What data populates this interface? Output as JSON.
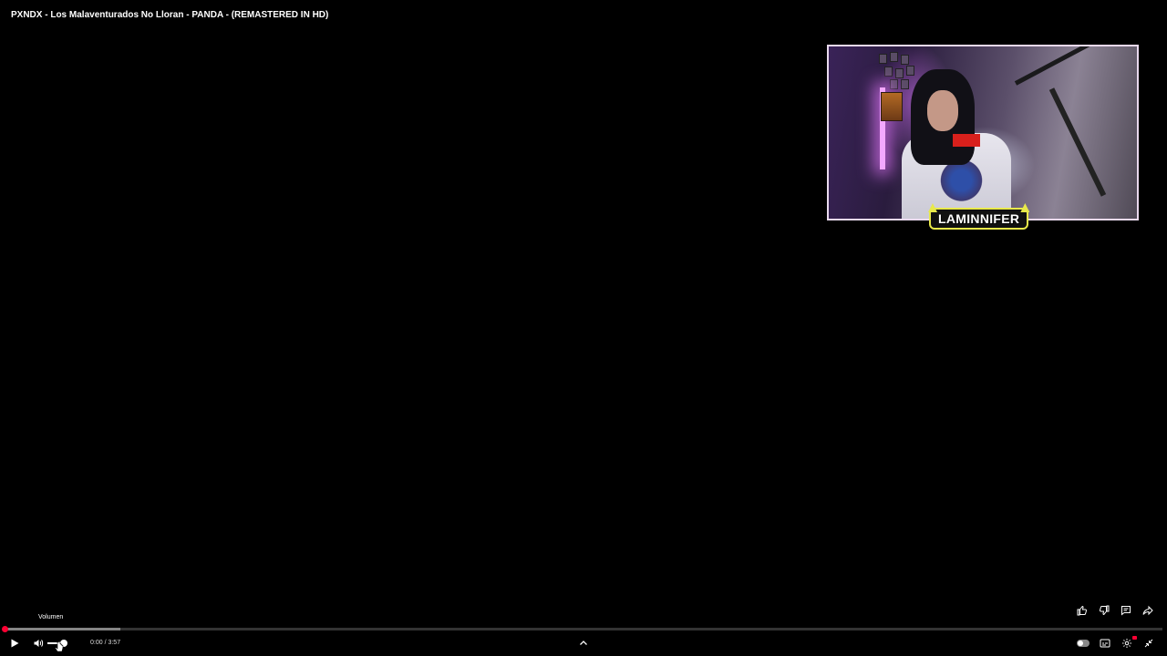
{
  "video": {
    "title": "PXNDX - Los Malaventurados No Lloran - PANDA - (REMASTERED IN HD)"
  },
  "webcam": {
    "streamer_name": "LAMINNIFER"
  },
  "actions": [
    {
      "name": "like-icon"
    },
    {
      "name": "dislike-icon"
    },
    {
      "name": "comments-icon"
    },
    {
      "name": "share-icon"
    }
  ],
  "tooltip": {
    "text": "Volumen"
  },
  "player": {
    "current_time": "0:00",
    "duration": "3:57",
    "time_display": "0:00 / 3:57",
    "progress_fraction": 0.0,
    "buffered_fraction": 0.1,
    "volume_fraction": 1.0,
    "autoplay_on": false
  },
  "colors": {
    "accent": "#ff0033",
    "background": "#000000",
    "webcam_border": "#e9d9ee",
    "nameplate_border": "#e8e94a"
  },
  "controls": {
    "play": "play-icon",
    "volume": "volume-icon",
    "chevron": "chevron-up-icon",
    "autoplay": "autoplay-toggle",
    "subtitles": "subtitles-icon",
    "settings": "gear-icon",
    "exit_fullscreen": "exit-fullscreen-icon"
  }
}
